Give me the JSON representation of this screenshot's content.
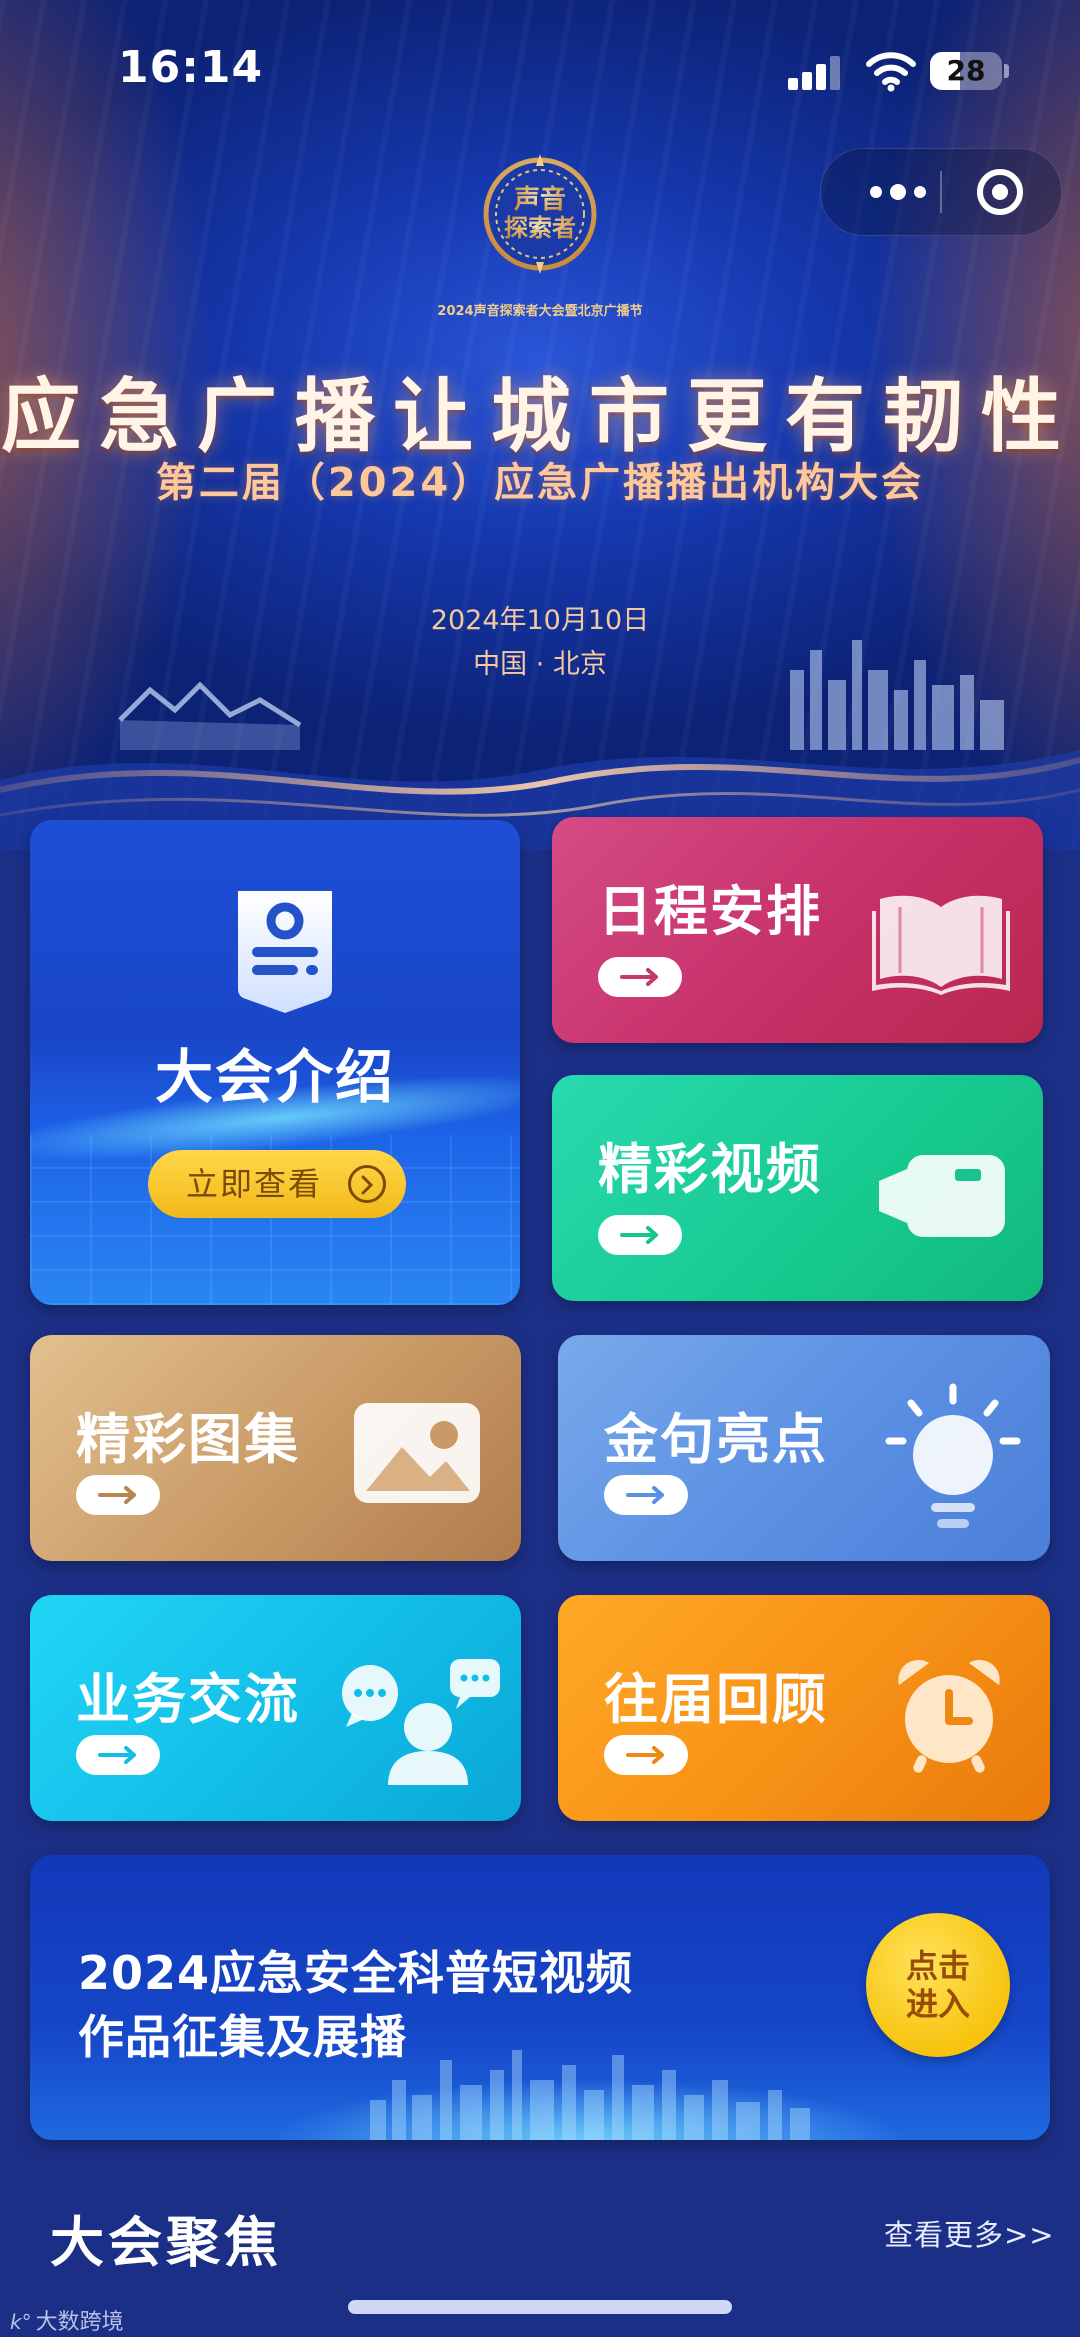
{
  "status_bar": {
    "time": "16:14",
    "battery": "28"
  },
  "banner": {
    "logo_text": "声音探索者",
    "logo_caption": "2024声音探索者大会暨北京广播节",
    "title": "应急广播让城市更有韧性",
    "subtitle": "第二届（2024）应急广播播出机构大会",
    "date": "2024年10月10日",
    "location": "中国 · 北京"
  },
  "tiles": {
    "intro": {
      "label": "大会介绍",
      "cta": "立即查看"
    },
    "schedule": {
      "label": "日程安排"
    },
    "video": {
      "label": "精彩视频"
    },
    "gallery": {
      "label": "精彩图集"
    },
    "quotes": {
      "label": "金句亮点"
    },
    "exchange": {
      "label": "业务交流"
    },
    "review": {
      "label": "往届回顾"
    }
  },
  "promo": {
    "line1": "2024应急安全科普短视频",
    "line2": "作品征集及展播",
    "button_line1": "点击",
    "button_line2": "进入"
  },
  "section": {
    "title": "大会聚焦",
    "more": "查看更多>>"
  },
  "watermark": "大数跨境",
  "icons": {
    "menu": "more-dots-icon",
    "close": "target-circle-icon",
    "intro": "id-badge-icon",
    "schedule": "open-book-icon",
    "video": "video-camera-icon",
    "gallery": "image-icon",
    "quotes": "light-bulb-icon",
    "exchange": "chat-user-icon",
    "review": "alarm-clock-icon"
  }
}
